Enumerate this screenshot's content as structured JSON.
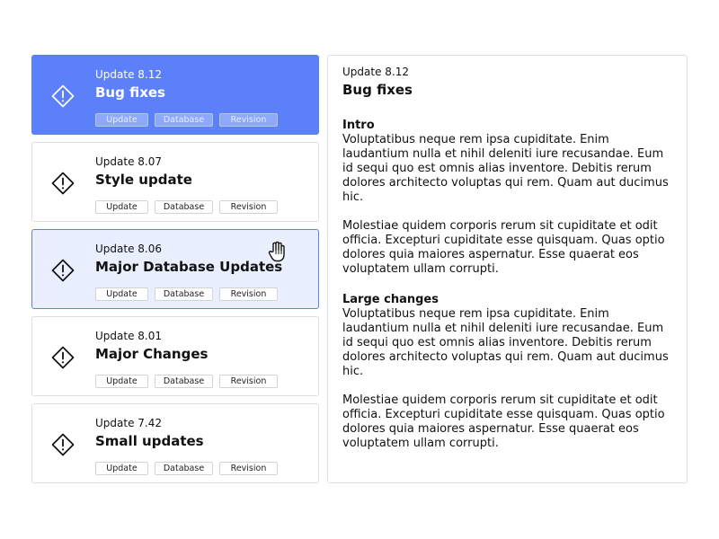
{
  "colors": {
    "accent": "#5b80fa",
    "hover_background": "#e9efff",
    "border": "#dcdfe6",
    "text": "#111111"
  },
  "icons": {
    "card_icon": "warning-diamond-icon",
    "cursor": "hand-pointer-cursor-icon"
  },
  "updates": [
    {
      "version": "Update 8.12",
      "title": "Bug fixes",
      "state": "selected",
      "tags": [
        "Update",
        "Database",
        "Revision"
      ]
    },
    {
      "version": "Update 8.07",
      "title": "Style update",
      "state": "default",
      "tags": [
        "Update",
        "Database",
        "Revision"
      ]
    },
    {
      "version": "Update 8.06",
      "title": "Major Database Updates",
      "state": "hovered",
      "tags": [
        "Update",
        "Database",
        "Revision"
      ]
    },
    {
      "version": "Update 8.01",
      "title": "Major Changes",
      "state": "default",
      "tags": [
        "Update",
        "Database",
        "Revision"
      ]
    },
    {
      "version": "Update 7.42",
      "title": "Small updates",
      "state": "default",
      "tags": [
        "Update",
        "Database",
        "Revision"
      ]
    }
  ],
  "detail": {
    "version": "Update 8.12",
    "title": "Bug fixes",
    "sections": [
      {
        "heading": "Intro",
        "paragraphs": [
          "Voluptatibus neque rem ipsa cupiditate. Enim laudantium nulla et nihil deleniti iure recusandae. Eum id sequi quo est omnis alias inventore. Debitis rerum dolores architecto voluptas qui rem. Quam aut ducimus hic.",
          "Molestiae quidem corporis rerum sit cupiditate et odit officia. Excepturi cupiditate esse quisquam. Quas optio dolores quia maiores aspernatur. Esse quaerat eos voluptatem ullam corrupti."
        ]
      },
      {
        "heading": "Large changes",
        "paragraphs": [
          "Voluptatibus neque rem ipsa cupiditate. Enim laudantium nulla et nihil deleniti iure recusandae. Eum id sequi quo est omnis alias inventore. Debitis rerum dolores architecto voluptas qui rem. Quam aut ducimus hic.",
          "Molestiae quidem corporis rerum sit cupiditate et odit officia. Excepturi cupiditate esse quisquam. Quas optio dolores quia maiores aspernatur. Esse quaerat eos voluptatem ullam corrupti."
        ]
      }
    ]
  }
}
